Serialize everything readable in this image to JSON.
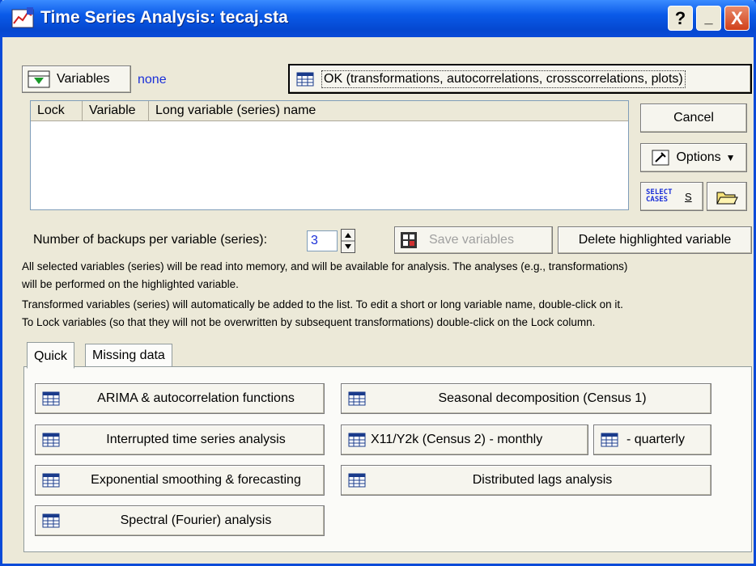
{
  "window": {
    "title": "Time Series Analysis: tecaj.sta",
    "help_label": "?",
    "minimize_label": "_",
    "close_label": "X"
  },
  "variables": {
    "button_label": "Variables",
    "value": "none"
  },
  "ok_button_label": "OK (transformations, autocorrelations, crosscorrelations, plots)",
  "cancel_label": "Cancel",
  "options_label": "Options",
  "select_cases_label": "SELECT CASES",
  "select_cases_s": "S",
  "list": {
    "columns": [
      "Lock",
      "Variable",
      "Long variable (series) name"
    ]
  },
  "backups": {
    "label": "Number of backups per variable (series):",
    "value": "3"
  },
  "save_variables_label": "Save variables",
  "delete_highlighted_label": "Delete highlighted variable",
  "info": {
    "line1": "All selected variables (series) will be read into memory, and will be available for analysis. The analyses (e.g., transformations)",
    "line2": "will be performed on the highlighted variable.",
    "line3": "Transformed variables (series) will automatically be added to the list. To edit a short or long variable name, double-click on it.",
    "line4": "To Lock variables (so that they will not be overwritten by subsequent transformations) double-click on the Lock column."
  },
  "tabs": [
    "Quick",
    "Missing data"
  ],
  "quick": {
    "arima": "ARIMA & autocorrelation functions",
    "interrupted": "Interrupted time series analysis",
    "exponential": "Exponential smoothing & forecasting",
    "spectral": "Spectral (Fourier) analysis",
    "seasonal": "Seasonal decomposition (Census 1)",
    "x11": "X11/Y2k (Census 2) - monthly",
    "quarterly": "- quarterly",
    "distributed": "Distributed lags analysis"
  }
}
